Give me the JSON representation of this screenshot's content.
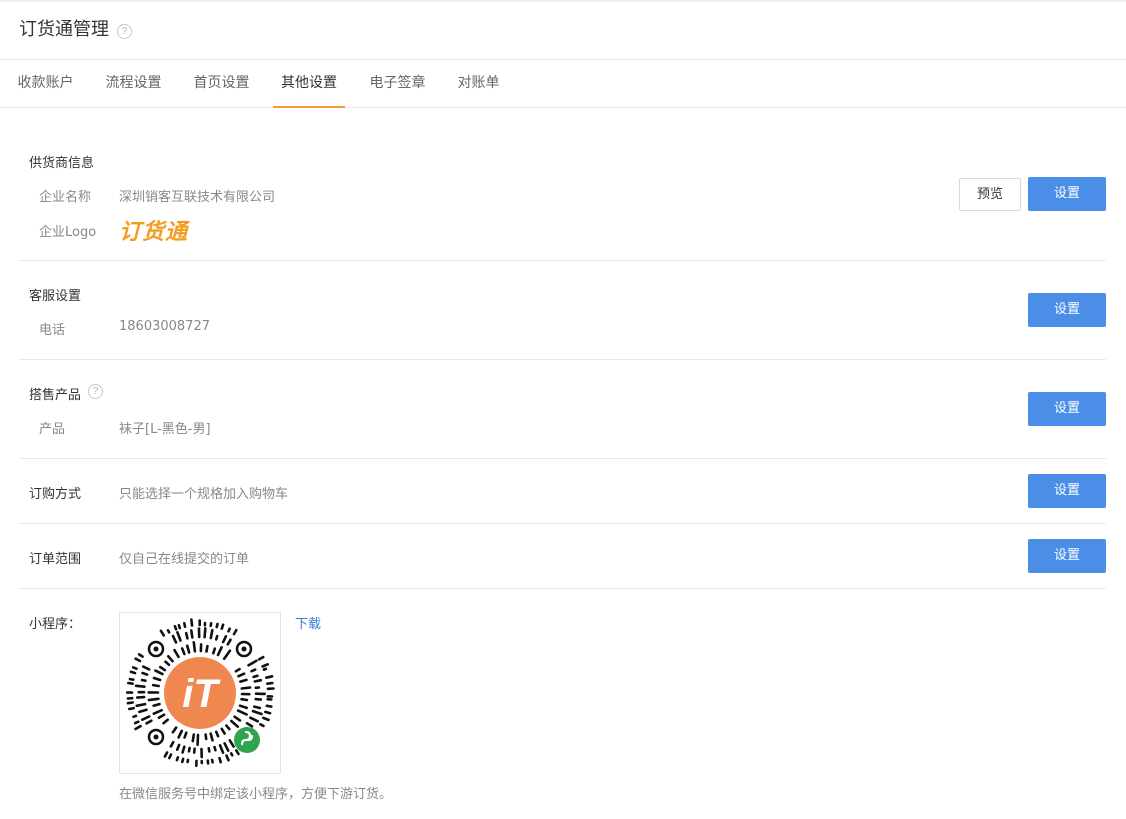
{
  "header": {
    "title": "订货通管理",
    "help": "?"
  },
  "tabs": [
    {
      "label": "收款账户"
    },
    {
      "label": "流程设置"
    },
    {
      "label": "首页设置"
    },
    {
      "label": "其他设置"
    },
    {
      "label": "电子签章"
    },
    {
      "label": "对账单"
    }
  ],
  "active_tab": "其他设置",
  "supplier": {
    "title": "供货商信息",
    "company_label": "企业名称",
    "company_value": "深圳销客互联技术有限公司",
    "logo_label": "企业Logo",
    "logo_text": "订货通",
    "preview_button": "预览",
    "set_button": "设置"
  },
  "service": {
    "title": "客服设置",
    "phone_label": "电话",
    "phone_value": "18603008727",
    "set_button": "设置"
  },
  "product": {
    "title": "搭售产品",
    "help": "?",
    "product_label": "产品",
    "product_value": "袜子[L-黑色-男]",
    "set_button": "设置"
  },
  "order_method": {
    "label": "订购方式",
    "value": "只能选择一个规格加入购物车",
    "set_button": "设置"
  },
  "order_scope": {
    "label": "订单范围",
    "value": "仅自己在线提交的订单",
    "set_button": "设置"
  },
  "mini_program": {
    "label": "小程序：",
    "download": "下载",
    "center_text": "iT",
    "hint": "在微信服务号中绑定该小程序，方便下游订货。"
  },
  "colors": {
    "accent": "#f39c3b",
    "primary_button": "#4a8ee8",
    "logo": "#f39c1f",
    "qr_center": "#f0874f",
    "wechat_badge": "#2ea44f",
    "link": "#3d7ad6"
  },
  "icons": {
    "title_help": "question-circle-icon",
    "product_help": "question-circle-icon",
    "qr": "mini-program-qr-code",
    "badge": "wechat-mini-program-icon"
  }
}
